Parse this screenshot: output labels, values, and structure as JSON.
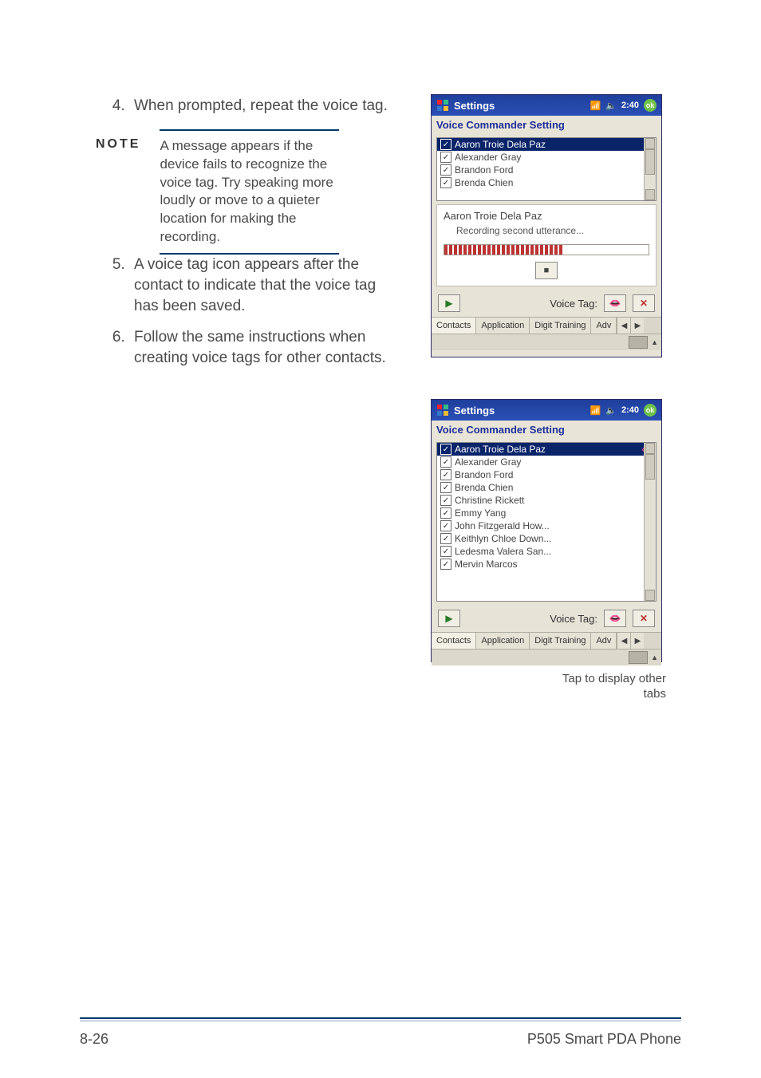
{
  "instructions": {
    "step4": "When prompted, repeat the voice tag.",
    "step5": "A voice tag icon appears after the contact to indicate that the voice tag has been saved.",
    "step6": "Follow the same instructions when creating voice tags for other contacts."
  },
  "note": {
    "label": "NOTE",
    "text": "A message appears if the device fails to recognize the voice tag. Try speaking more loudly or move to a quieter location for making the recording."
  },
  "screens": {
    "titlebar": {
      "title": "Settings",
      "time": "2:40",
      "ok": "ok"
    },
    "subtitle": "Voice Commander Setting",
    "recording": {
      "name": "Aaron Troie Dela Paz",
      "status": "Recording second utterance..."
    },
    "voice_tag_label": "Voice Tag:",
    "tabs": {
      "t1": "Contacts",
      "t2": "Application",
      "t3": "Digit Training",
      "t4": "Adv"
    },
    "contacts_short": [
      "Aaron Troie Dela Paz",
      "Alexander Gray",
      "Brandon Ford",
      "Brenda Chien"
    ],
    "contacts_long": [
      "Aaron Troie Dela Paz",
      "Alexander Gray",
      "Brandon Ford",
      "Brenda Chien",
      "Christine Rickett",
      "Emmy Yang",
      "John Fitzgerald How...",
      "Keithlyn Chloe Down...",
      "Ledesma Valera San...",
      "Mervin Marcos"
    ]
  },
  "caption": "Tap to display other tabs",
  "footer": {
    "left": "8-26",
    "right": "P505 Smart PDA Phone"
  }
}
